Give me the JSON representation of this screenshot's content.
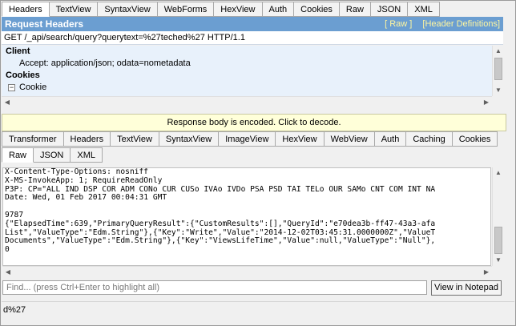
{
  "request_tabs": [
    {
      "label": "Headers",
      "active": true
    },
    {
      "label": "TextView",
      "active": false
    },
    {
      "label": "SyntaxView",
      "active": false
    },
    {
      "label": "WebForms",
      "active": false
    },
    {
      "label": "HexView",
      "active": false
    },
    {
      "label": "Auth",
      "active": false
    },
    {
      "label": "Cookies",
      "active": false
    },
    {
      "label": "Raw",
      "active": false
    },
    {
      "label": "JSON",
      "active": false
    },
    {
      "label": "XML",
      "active": false
    }
  ],
  "request_headers": {
    "title": "Request Headers",
    "raw_link": "[ Raw ]",
    "definitions_link": "[Header Definitions]",
    "request_line": "GET /_api/search/query?querytext=%27teched%27 HTTP/1.1",
    "client_section": "Client",
    "accept_header": "Accept: application/json; odata=nometadata",
    "cookies_section": "Cookies",
    "cookie_toggle": "−",
    "cookie_item": "Cookie"
  },
  "encoded_notice": "Response body is encoded. Click to decode.",
  "response_tabs_row1": [
    {
      "label": "Transformer"
    },
    {
      "label": "Headers"
    },
    {
      "label": "TextView"
    },
    {
      "label": "SyntaxView"
    },
    {
      "label": "ImageView"
    },
    {
      "label": "HexView"
    },
    {
      "label": "WebView"
    },
    {
      "label": "Auth"
    },
    {
      "label": "Caching"
    },
    {
      "label": "Cookies"
    }
  ],
  "response_tabs_row2": [
    {
      "label": "Raw",
      "active": true
    },
    {
      "label": "JSON",
      "active": false
    },
    {
      "label": "XML",
      "active": false
    }
  ],
  "response_lines": [
    "X-Content-Type-Options: nosniff",
    "X-MS-InvokeApp: 1; RequireReadOnly",
    "P3P: CP=\"ALL IND DSP COR ADM CONo CUR CUSo IVAo IVDo PSA PSD TAI TELo OUR SAMo CNT COM INT NA",
    "Date: Wed, 01 Feb 2017 00:04:31 GMT",
    "",
    "9787",
    "{\"ElapsedTime\":639,\"PrimaryQueryResult\":{\"CustomResults\":[],\"QueryId\":\"e70dea3b-ff47-43a3-afa",
    "List\",\"ValueType\":\"Edm.String\"},{\"Key\":\"Write\",\"Value\":\"2014-12-02T03:45:31.0000000Z\",\"ValueT",
    "Documents\",\"ValueType\":\"Edm.String\"},{\"Key\":\"ViewsLifeTime\",\"Value\":null,\"ValueType\":\"Null\"},",
    "0"
  ],
  "find": {
    "placeholder": "Find... (press Ctrl+Enter to highlight all)",
    "notepad_button": "View in Notepad"
  },
  "status_text": "d%27"
}
